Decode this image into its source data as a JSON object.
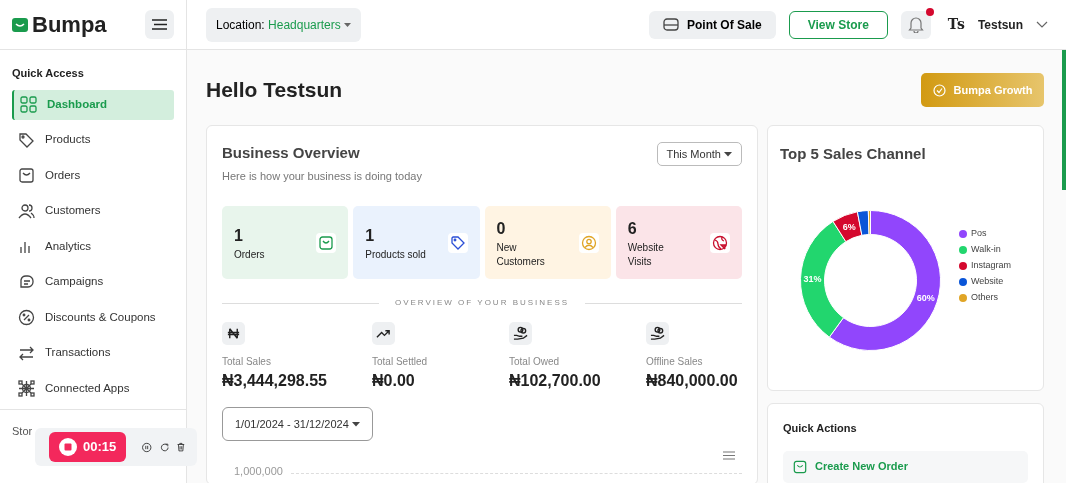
{
  "brand": {
    "name": "Bumpa"
  },
  "topbar": {
    "location_label": "Location:",
    "location_value": "Headquarters",
    "point_of_sale": "Point Of Sale",
    "view_store": "View Store",
    "notification_unread": true,
    "user_initials": "Ts",
    "user_name": "Testsun"
  },
  "sidebar": {
    "section": "Quick Access",
    "items": [
      {
        "label": "Dashboard",
        "selected": true
      },
      {
        "label": "Products",
        "selected": false
      },
      {
        "label": "Orders",
        "selected": false
      },
      {
        "label": "Customers",
        "selected": false
      },
      {
        "label": "Analytics",
        "selected": false
      },
      {
        "label": "Campaigns",
        "selected": false
      },
      {
        "label": "Discounts & Coupons",
        "selected": false
      },
      {
        "label": "Transactions",
        "selected": false
      },
      {
        "label": "Connected Apps",
        "selected": false
      }
    ],
    "section_2": "Stor"
  },
  "recorder": {
    "time": "00:15"
  },
  "greeting": "Hello Testsun",
  "growth_button": "Bumpa Growth",
  "overview": {
    "title": "Business Overview",
    "subtitle": "Here is how your business is doing today",
    "period": "This Month",
    "stats": [
      {
        "value": "1",
        "label": "Orders",
        "color": "#e8f5ec"
      },
      {
        "value": "1",
        "label": "Products sold",
        "color": "#eaf2fd"
      },
      {
        "value": "0",
        "label": "New Customers",
        "color": "#fff4e3"
      },
      {
        "value": "6",
        "label": "Website Visits",
        "color": "#fbe4e8"
      }
    ],
    "divider_label": "OVERVIEW OF YOUR BUSINESS",
    "totals": [
      {
        "label": "Total Sales",
        "value": "₦3,444,298.55"
      },
      {
        "label": "Total Settled",
        "value": "₦0.00"
      },
      {
        "label": "Total Owed",
        "value": "₦102,700.00"
      },
      {
        "label": "Offline Sales",
        "value": "₦840,000.00"
      }
    ],
    "date_range": "1/01/2024 - 31/12/2024",
    "chart_tick": "1,000,000"
  },
  "sales_channels": {
    "title": "Top 5 Sales Channel",
    "chart_data": {
      "type": "donut",
      "categories": [
        "Pos",
        "Walk-in",
        "Instagram",
        "Website",
        "Others"
      ],
      "values": [
        60,
        31,
        6,
        2.5,
        0.5
      ],
      "colors": [
        "#9146fc",
        "#22d66e",
        "#d4082e",
        "#0a55d8",
        "#e0a526"
      ],
      "value_labels": [
        "60%",
        "31%",
        "6%",
        null,
        null
      ]
    }
  },
  "quick_actions": {
    "title": "Quick Actions",
    "items": [
      "Create New Order"
    ]
  }
}
